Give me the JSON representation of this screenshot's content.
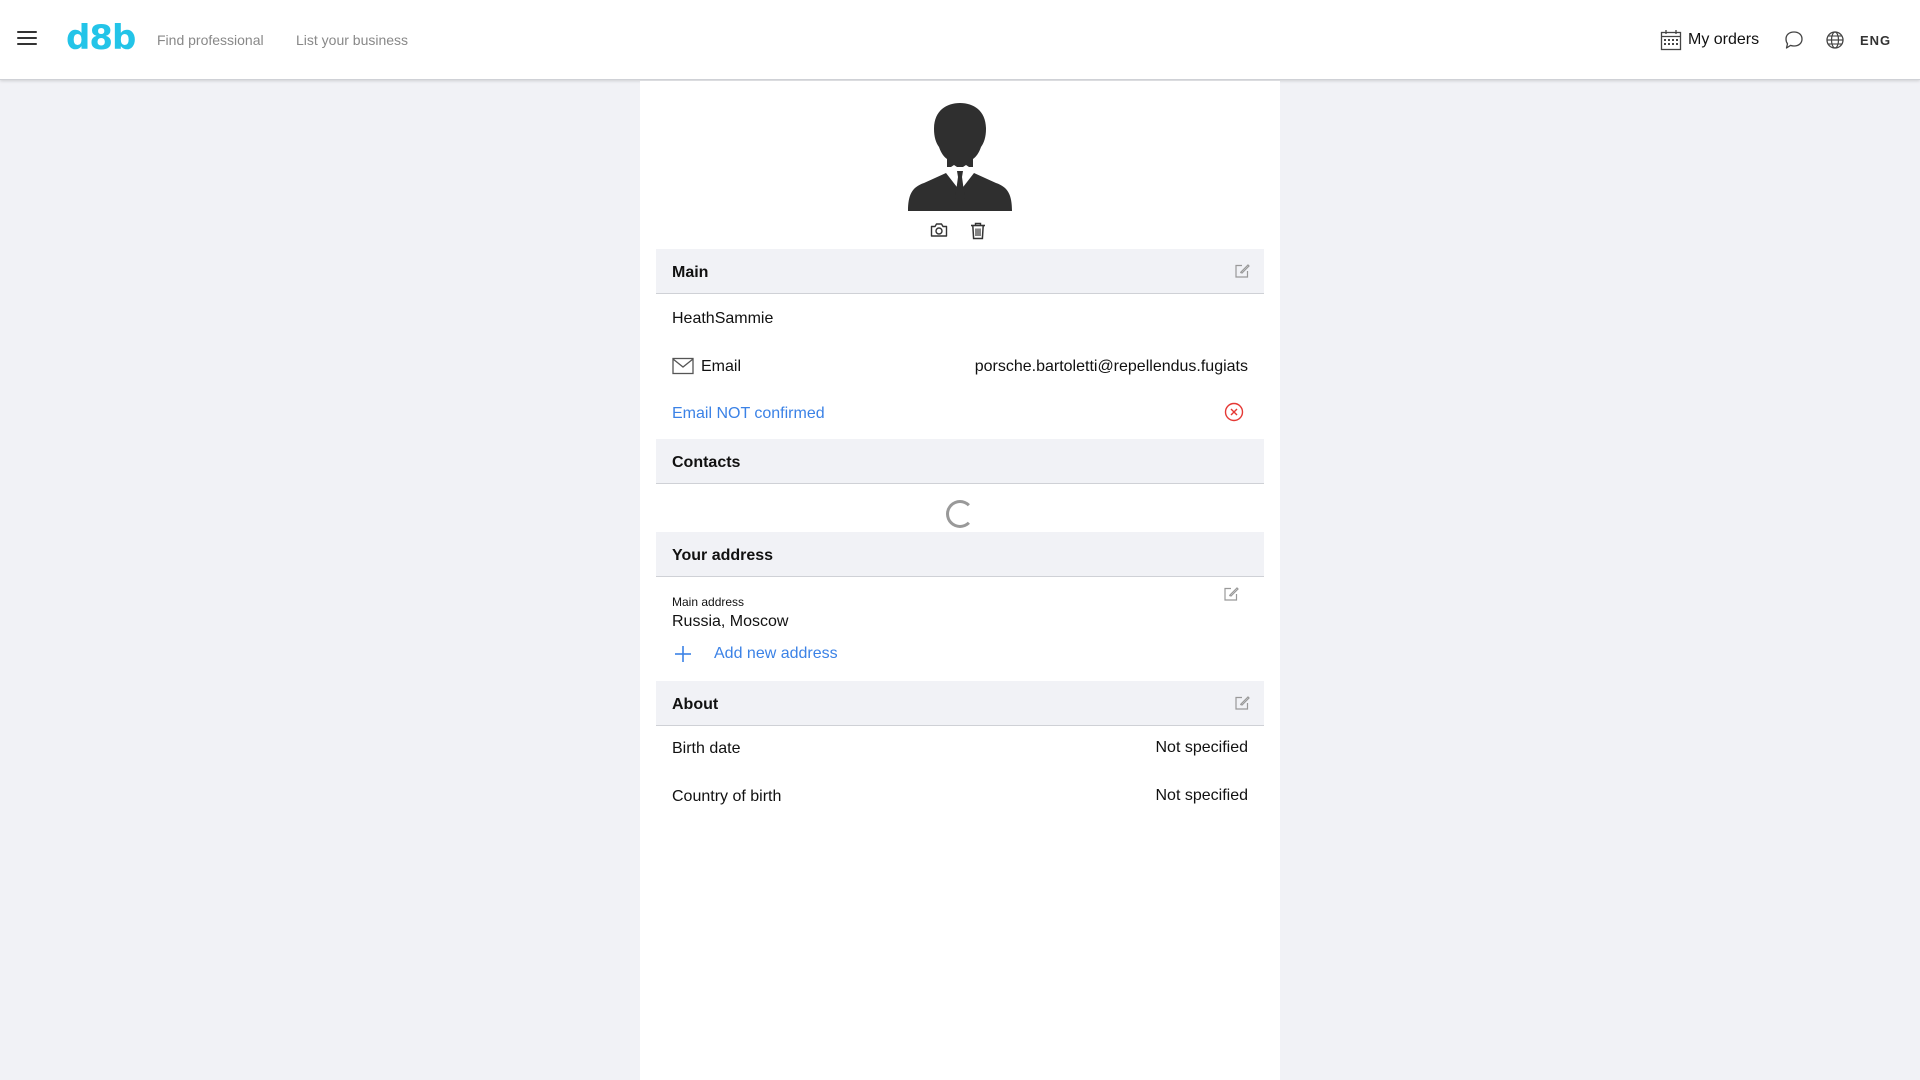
{
  "header": {
    "logo": "d8b",
    "nav": {
      "find_professional": "Find professional",
      "list_business": "List your business"
    },
    "my_orders": "My orders",
    "language": "ENG"
  },
  "icons": {
    "menu": "hamburger-icon",
    "orders": "calendar-icon",
    "chat": "chat-icon",
    "language": "globe-icon",
    "camera": "camera-icon",
    "delete": "trash-icon",
    "edit": "edit-icon",
    "email": "envelope-icon",
    "unconfirmed": "x-circle-icon",
    "add": "plus-icon",
    "loading": "spinner-icon"
  },
  "profile": {
    "main": {
      "title": "Main",
      "username": "HeathSammie",
      "email_label": "Email",
      "email_value": "porsche.bartoletti@repellendus.fugiats",
      "email_status": "Email NOT confirmed"
    },
    "contacts": {
      "title": "Contacts"
    },
    "address": {
      "title": "Your address",
      "main_label": "Main address",
      "main_value": "Russia, Moscow",
      "add_label": "Add new address"
    },
    "about": {
      "title": "About",
      "birth_date_label": "Birth date",
      "birth_date_value": "Not specified",
      "country_label": "Country of birth",
      "country_value": "Not specified"
    }
  },
  "colors": {
    "logo": "#23c4e8",
    "link": "#3b82e6",
    "error": "#e53935",
    "section_bg": "#f1f2f6"
  }
}
